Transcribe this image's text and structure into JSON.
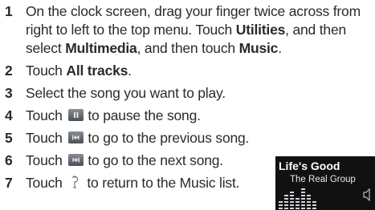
{
  "steps": [
    {
      "num": "1",
      "t1": "On the clock screen, drag your finger twice across from right to left to the top menu. Touch ",
      "b1": "Utilities",
      "t2": ", and then select ",
      "b2": "Multimedia",
      "t3": ", and then touch ",
      "b3": "Music",
      "t4": "."
    },
    {
      "num": "2",
      "t1": "Touch ",
      "b1": "All tracks",
      "t2": "."
    },
    {
      "num": "3",
      "t1": "Select the song you want to play."
    },
    {
      "num": "4",
      "t1": "Touch ",
      "icon": "pause-icon",
      "t2": "to pause the song."
    },
    {
      "num": "5",
      "t1": "Touch ",
      "icon": "previous-song-icon",
      "t2": "to go to the previous song."
    },
    {
      "num": "6",
      "t1": "Touch ",
      "icon": "next-song-icon",
      "t2": "to go to the next song."
    },
    {
      "num": "7",
      "t1": "Touch ",
      "icon": "back-arrow-icon",
      "t2": "to return to the Music list."
    }
  ],
  "player": {
    "title": "Life's Good",
    "artist": "The Real Group",
    "icons": [
      "equalizer-bars-icon",
      "speaker-icon"
    ]
  }
}
